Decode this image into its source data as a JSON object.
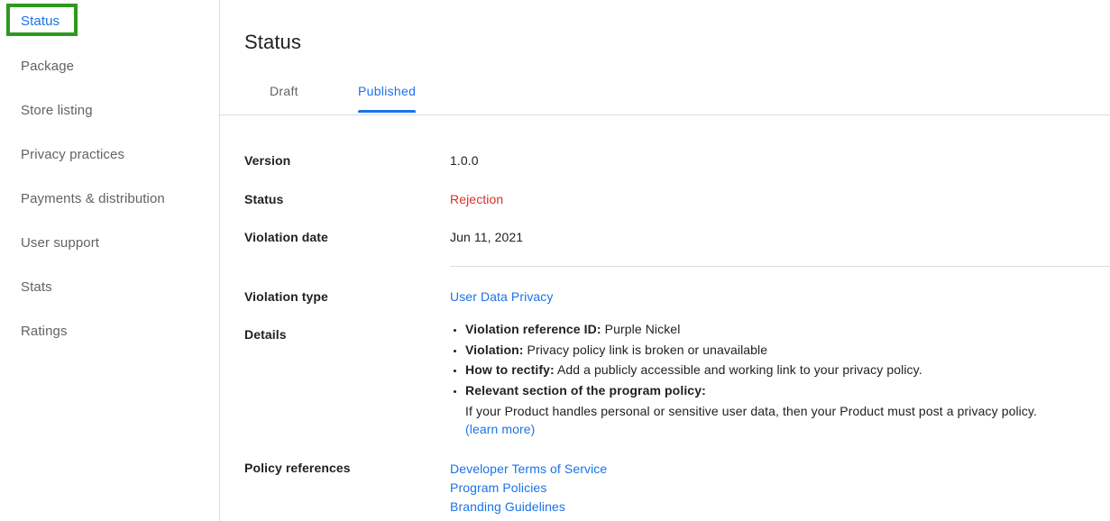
{
  "sidebar": {
    "items": [
      {
        "label": "Status",
        "active": true,
        "highlighted": true
      },
      {
        "label": "Package",
        "active": false,
        "highlighted": false
      },
      {
        "label": "Store listing",
        "active": false,
        "highlighted": false
      },
      {
        "label": "Privacy practices",
        "active": false,
        "highlighted": false
      },
      {
        "label": "Payments & distribution",
        "active": false,
        "highlighted": false
      },
      {
        "label": "User support",
        "active": false,
        "highlighted": false
      },
      {
        "label": "Stats",
        "active": false,
        "highlighted": false
      },
      {
        "label": "Ratings",
        "active": false,
        "highlighted": false
      }
    ],
    "highlight_color": "#2d9a1f"
  },
  "main": {
    "title": "Status",
    "tabs": [
      {
        "label": "Draft",
        "active": false
      },
      {
        "label": "Published",
        "active": true
      }
    ],
    "fields": {
      "version_label": "Version",
      "version_value": "1.0.0",
      "status_label": "Status",
      "status_value": "Rejection",
      "violation_date_label": "Violation date",
      "violation_date_value": "Jun 11, 2021",
      "violation_type_label": "Violation type",
      "violation_type_value": "User Data Privacy",
      "details_label": "Details",
      "policy_references_label": "Policy references"
    },
    "details": [
      {
        "key": "Violation reference ID:",
        "text": " Purple Nickel"
      },
      {
        "key": "Violation:",
        "text": " Privacy policy link is broken or unavailable"
      },
      {
        "key": "How to rectify:",
        "text": " Add a publicly accessible and working link to your privacy policy."
      },
      {
        "key": "Relevant section of the program policy:",
        "text": "",
        "sub_text": "If your Product handles personal or sensitive user data, then your Product must post a privacy policy.",
        "sub_link": "(learn more)"
      }
    ],
    "policy_references": [
      "Developer Terms of Service",
      "Program Policies",
      "Branding Guidelines"
    ],
    "colors": {
      "accent": "#1a73e8",
      "error": "#d93025",
      "text": "#202124",
      "muted": "#5f6368",
      "border": "#dadce0"
    }
  }
}
